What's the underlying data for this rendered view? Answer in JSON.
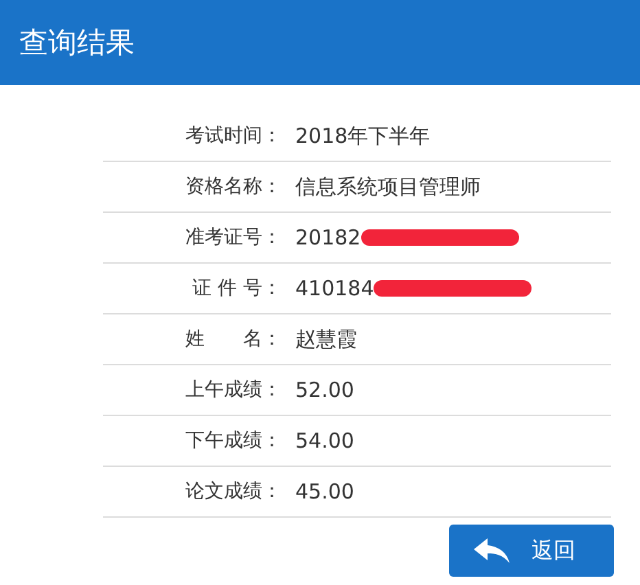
{
  "header": {
    "title": "查询结果"
  },
  "rows": [
    {
      "label": "考试时间：",
      "value": "2018年下半年",
      "redacted": false
    },
    {
      "label": "资格名称：",
      "value": "信息系统项目管理师",
      "redacted": false
    },
    {
      "label": "准考证号：",
      "value": "20182",
      "redacted": true
    },
    {
      "label": "证 件 号：",
      "value": "410184",
      "redacted": true
    },
    {
      "label": "姓　　名：",
      "value": "赵慧霞",
      "redacted": false
    },
    {
      "label": "上午成绩：",
      "value": "52.00",
      "redacted": false
    },
    {
      "label": "下午成绩：",
      "value": "54.00",
      "redacted": false
    },
    {
      "label": "论文成绩：",
      "value": "45.00",
      "redacted": false
    }
  ],
  "back_button": {
    "label": "返回"
  }
}
